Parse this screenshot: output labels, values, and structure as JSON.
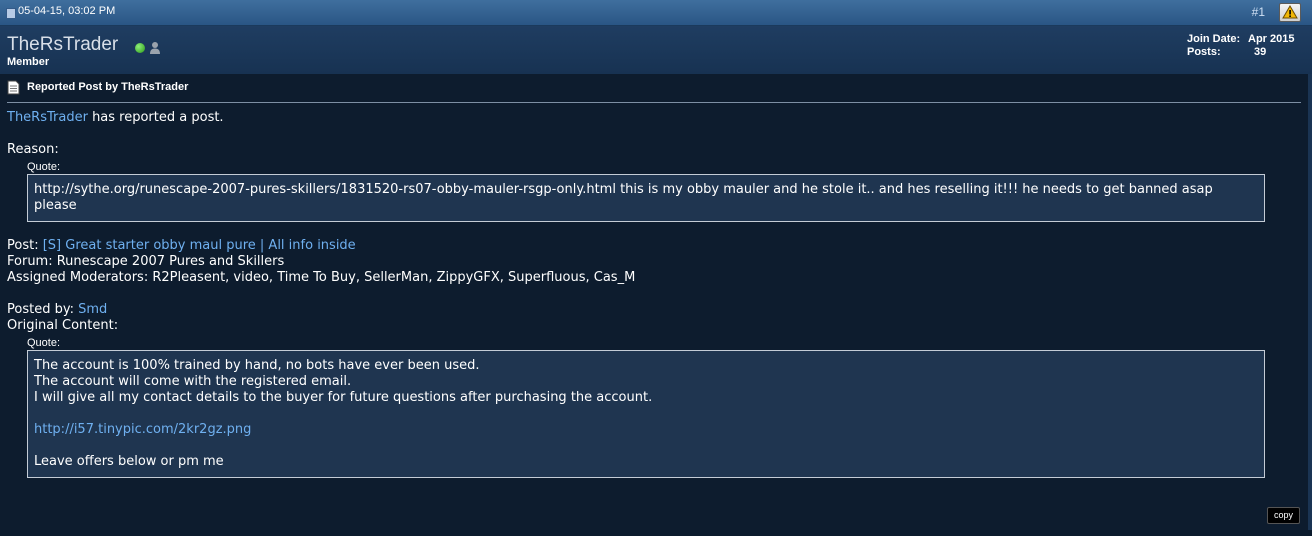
{
  "post_header": {
    "date": "05-04-15, 03:02 PM",
    "post_number": "#1",
    "report_icon": "warning-triangle-icon"
  },
  "user": {
    "name": "TheRsTrader",
    "title": "Member",
    "online_icon": "online-status-icon",
    "profile_icon": "user-profile-icon",
    "join_date_label": "Join Date:",
    "join_date": "Apr 2015",
    "posts_label": "Posts:",
    "posts": "39"
  },
  "post": {
    "title": "Reported Post by TheRsTrader",
    "reporter": "TheRsTrader",
    "reported_text": "has reported a post.",
    "reason_label": "Reason:",
    "quote_label": "Quote:",
    "reason_quote": "http://sythe.org/runescape-2007-pures-skillers/1831520-rs07-obby-mauler-rsgp-only.html this is my obby mauler and he stole it.. and hes reselling it!!! he needs to get banned asap please",
    "post_label": "Post:",
    "post_link": "[S] Great starter obby maul pure | All info inside",
    "forum_line": "Forum: Runescape 2007 Pures and Skillers",
    "moderators_line": "Assigned Moderators: R2Pleasent, video, Time To Buy, SellerMan, ZippyGFX, Superfluous, Cas_M",
    "posted_by_label": "Posted by:",
    "posted_by": "Smd",
    "original_content_label": "Original Content:",
    "original_quote": {
      "line1": "The account is 100% trained by hand, no bots have ever been used.",
      "line2": "The account will come with the registered email.",
      "line3": "I will give all my contact details to the buyer for future questions after purchasing the account.",
      "link": "http://i57.tinypic.com/2kr2gz.png",
      "line4": "Leave offers below or pm me"
    }
  },
  "copy_button": "copy",
  "colors": {
    "link": "#6fb0f0",
    "header_bar": "#2a5685",
    "background": "#0d1c2e",
    "quote_bg": "#1f3550"
  }
}
